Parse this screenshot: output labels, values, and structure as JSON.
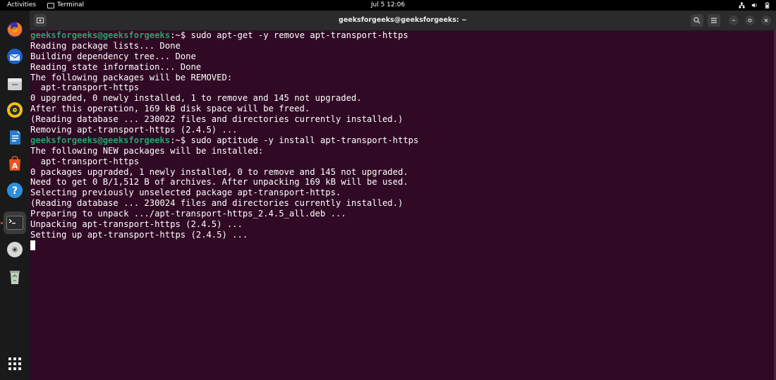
{
  "topbar": {
    "activities": "Activities",
    "app_name": "Terminal",
    "clock": "Jul 5  12:06"
  },
  "dock": {
    "items": [
      {
        "name": "firefox"
      },
      {
        "name": "thunderbird"
      },
      {
        "name": "files"
      },
      {
        "name": "rhythmbox"
      },
      {
        "name": "libreoffice-writer"
      },
      {
        "name": "app-center"
      },
      {
        "name": "help"
      },
      {
        "name": "terminal",
        "active": true
      },
      {
        "name": "optical-disc"
      },
      {
        "name": "trash"
      },
      {
        "name": "show-apps"
      }
    ]
  },
  "window": {
    "title": "geeksforgeeks@geeksforgeeks: ~"
  },
  "terminal": {
    "user_host": "geeksforgeeks@geeksforgeeks",
    "path": ":~",
    "prompt_symbol": "$ ",
    "lines": [
      {
        "type": "prompt",
        "command": "sudo apt-get -y remove apt-transport-https"
      },
      {
        "type": "out",
        "text": "Reading package lists... Done"
      },
      {
        "type": "out",
        "text": "Building dependency tree... Done"
      },
      {
        "type": "out",
        "text": "Reading state information... Done"
      },
      {
        "type": "out",
        "text": "The following packages will be REMOVED:"
      },
      {
        "type": "out",
        "text": "  apt-transport-https"
      },
      {
        "type": "out",
        "text": "0 upgraded, 0 newly installed, 1 to remove and 145 not upgraded."
      },
      {
        "type": "out",
        "text": "After this operation, 169 kB disk space will be freed."
      },
      {
        "type": "out",
        "text": "(Reading database ... 230022 files and directories currently installed.)"
      },
      {
        "type": "out",
        "text": "Removing apt-transport-https (2.4.5) ..."
      },
      {
        "type": "prompt",
        "command": "sudo aptitude -y install apt-transport-https"
      },
      {
        "type": "out",
        "text": "The following NEW packages will be installed:"
      },
      {
        "type": "out",
        "text": "  apt-transport-https"
      },
      {
        "type": "out",
        "text": "0 packages upgraded, 1 newly installed, 0 to remove and 145 not upgraded."
      },
      {
        "type": "out",
        "text": "Need to get 0 B/1,512 B of archives. After unpacking 169 kB will be used."
      },
      {
        "type": "out",
        "text": "Selecting previously unselected package apt-transport-https."
      },
      {
        "type": "out",
        "text": "(Reading database ... 230024 files and directories currently installed.)"
      },
      {
        "type": "out",
        "text": "Preparing to unpack .../apt-transport-https_2.4.5_all.deb ..."
      },
      {
        "type": "out",
        "text": "Unpacking apt-transport-https (2.4.5) ..."
      },
      {
        "type": "out",
        "text": "Setting up apt-transport-https (2.4.5) ..."
      },
      {
        "type": "cursor"
      }
    ]
  },
  "colors": {
    "terminal_bg": "#300a24",
    "prompt_user": "#26a269",
    "accent": "#e95420"
  }
}
